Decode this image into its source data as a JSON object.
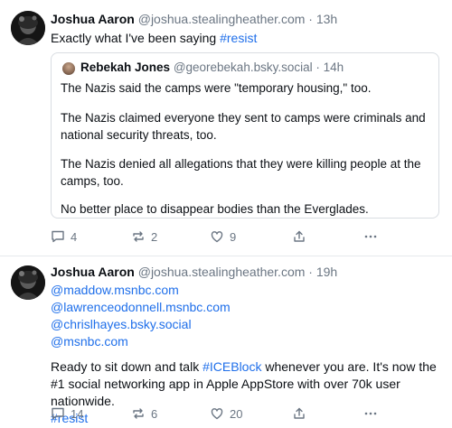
{
  "posts": [
    {
      "author": "Joshua Aaron",
      "handle": "@joshua.stealingheather.com",
      "separator": "·",
      "time": "13h",
      "text_prefix": "Exactly what I've been saying ",
      "hashtag": "#resist",
      "quote": {
        "author": "Rebekah Jones",
        "handle": "@georebekah.bsky.social",
        "separator": "·",
        "time": "14h",
        "paragraphs": [
          "The Nazis said the camps were \"temporary housing,\" too.",
          "The Nazis claimed everyone they sent to camps were criminals and national security threats, too.",
          "The Nazis denied all allegations that they were killing people at the camps, too.",
          "No better place to disappear bodies than the Everglades."
        ]
      },
      "actions": {
        "replies": "4",
        "reposts": "2",
        "likes": "9"
      }
    },
    {
      "author": "Joshua Aaron",
      "handle": "@joshua.stealingheather.com",
      "separator": "·",
      "time": "19h",
      "mentions": [
        "@maddow.msnbc.com",
        "@lawrenceodonnell.msnbc.com",
        "@chrislhayes.bsky.social",
        "@msnbc.com"
      ],
      "text_1": "Ready to sit down and talk ",
      "hashtag_1": "#ICEBlock",
      "text_2": " whenever you are. It's now the #1 social networking app in Apple AppStore with over 70k user nationwide.",
      "hashtag_2": "#resist",
      "actions": {
        "replies": "14",
        "reposts": "6",
        "likes": "20"
      }
    }
  ],
  "icons": {
    "reply": "speech-bubble-icon",
    "repost": "repost-arrows-icon",
    "like": "heart-icon",
    "share": "share-upload-icon",
    "more": "ellipsis-icon"
  },
  "colors": {
    "link": "#1f6fea",
    "muted": "#6b7683",
    "text": "#0b0f14",
    "border": "#d9dde2"
  }
}
